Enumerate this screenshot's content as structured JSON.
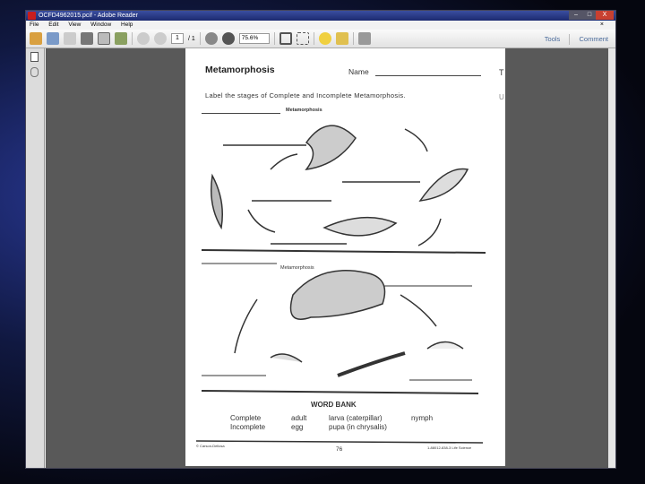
{
  "window": {
    "title": "OCFD4962015.pcif - Adobe Reader",
    "controls": [
      "–",
      "□",
      "X"
    ]
  },
  "menu": [
    "File",
    "Edit",
    "View",
    "Window",
    "Help"
  ],
  "toolbar": {
    "page_current": "1",
    "page_total": "/ 1",
    "zoom": "75.6%",
    "tools": "Tools",
    "comment": "Comment"
  },
  "icons": [
    "create-pdf-icon",
    "edit-icon",
    "save-icon",
    "print-icon",
    "email-icon",
    "review-icon",
    "prev-page-icon",
    "next-page-icon",
    "zoom-out-icon",
    "zoom-in-icon",
    "fit-page-icon",
    "scroll-icon",
    "comment-icon",
    "sign-icon",
    "fullscreen-icon"
  ],
  "document": {
    "title": "Metamorphosis",
    "name_label": "Name",
    "instruction": "Label the stages of Complete and Incomplete Metamorphosis.",
    "section1": "Metamorphosis",
    "section2": "Metamorphosis",
    "word_bank_title": "WORD BANK",
    "word_bank": [
      [
        "Complete",
        "Incomplete"
      ],
      [
        "adult",
        "egg"
      ],
      [
        "larva (caterpillar)",
        "pupa (in chrysalis)"
      ],
      [
        "nymph"
      ]
    ],
    "footer_left": "© Carson-Dellosa",
    "page_number": "76",
    "footer_right": "1-88012-838-3 Life Science",
    "edge_letters": [
      "T",
      "U"
    ]
  }
}
